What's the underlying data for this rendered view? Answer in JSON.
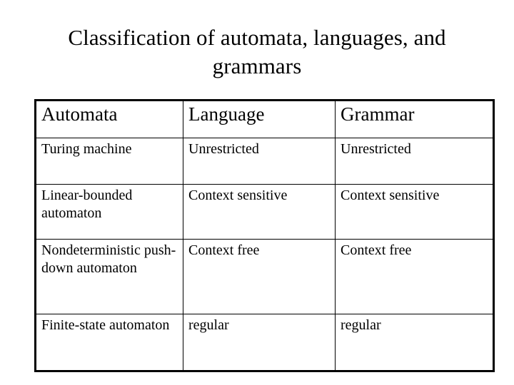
{
  "slide": {
    "title": "Classification of automata, languages, and grammars"
  },
  "table": {
    "headers": [
      "Automata",
      "Language",
      "Grammar"
    ],
    "rows": [
      {
        "automata": "Turing machine",
        "language": "Unrestricted",
        "grammar": "Unrestricted"
      },
      {
        "automata": "Linear-bounded automaton",
        "language": "Context sensitive",
        "grammar": "Context sensitive"
      },
      {
        "automata": "Nondeterministic push-down automaton",
        "language": "Context free",
        "grammar": "Context free"
      },
      {
        "automata": "Finite-state automaton",
        "language": "regular",
        "grammar": "regular"
      }
    ]
  },
  "colors": {
    "text": "#000000",
    "background": "#ffffff",
    "border": "#000000"
  }
}
